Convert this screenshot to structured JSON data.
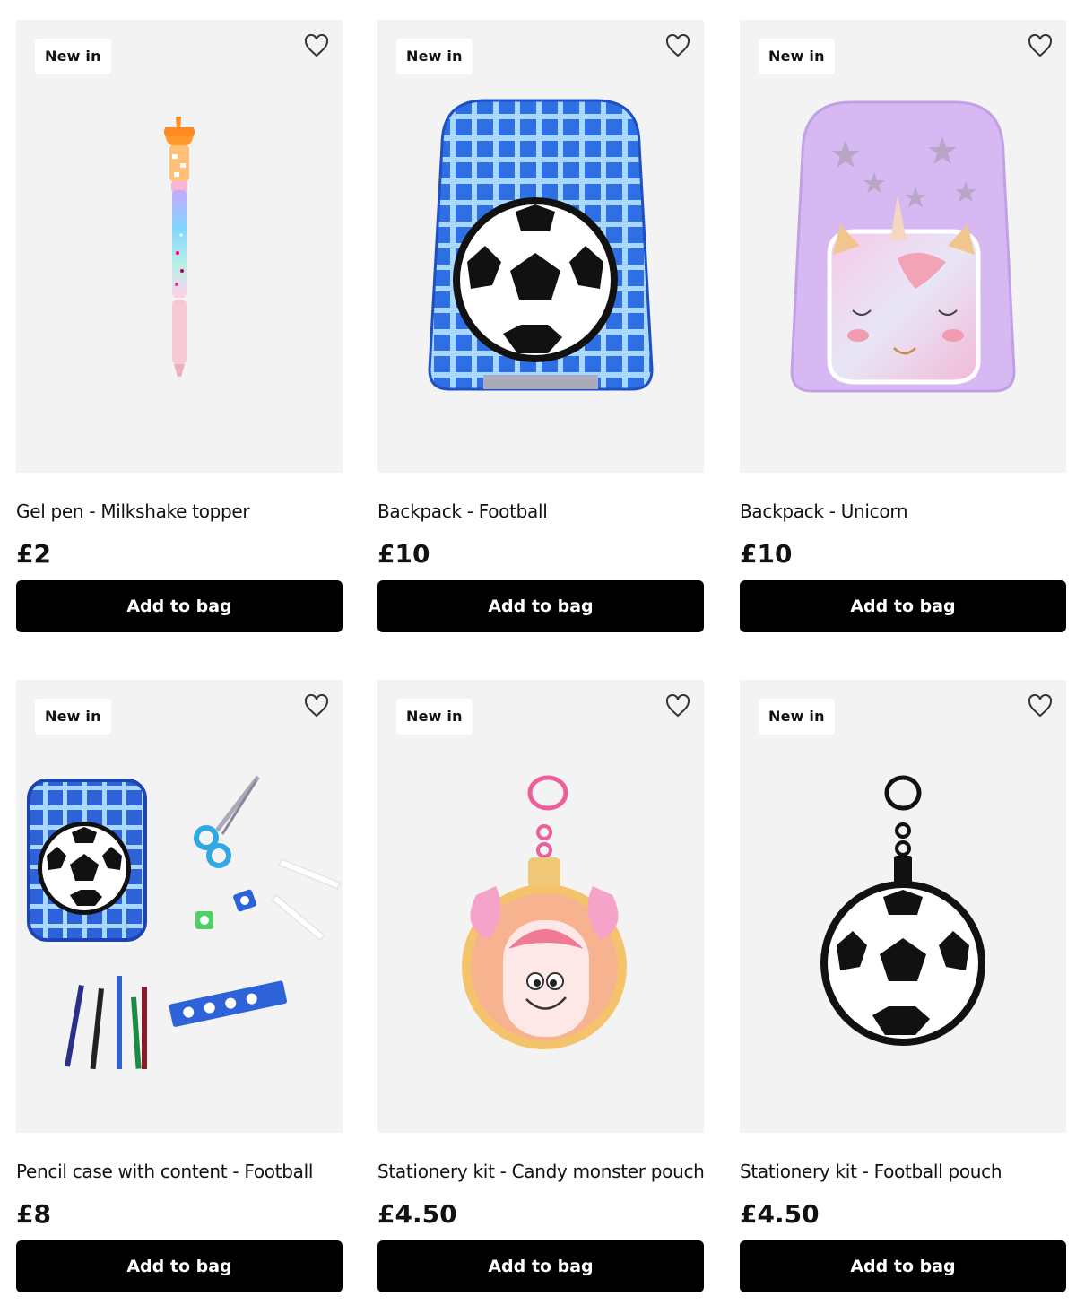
{
  "products": [
    {
      "badge": "New in",
      "name": "Gel pen - Milkshake topper",
      "price": "£2",
      "cta": "Add to bag",
      "image": "gel-pen-image"
    },
    {
      "badge": "New in",
      "name": "Backpack - Football",
      "price": "£10",
      "cta": "Add to bag",
      "image": "football-backpack-image"
    },
    {
      "badge": "New in",
      "name": "Backpack - Unicorn",
      "price": "£10",
      "cta": "Add to bag",
      "image": "unicorn-backpack-image"
    },
    {
      "badge": "New in",
      "name": "Pencil case with content - Football",
      "price": "£8",
      "cta": "Add to bag",
      "image": "pencil-case-image"
    },
    {
      "badge": "New in",
      "name": "Stationery kit - Candy monster pouch",
      "price": "£4.50",
      "cta": "Add to bag",
      "image": "candy-monster-pouch-image"
    },
    {
      "badge": "New in",
      "name": "Stationery kit - Football pouch",
      "price": "£4.50",
      "cta": "Add to bag",
      "image": "football-pouch-image"
    }
  ],
  "colors": {
    "image_bg": "#f3f3f3",
    "button_bg": "#000000",
    "button_text": "#ffffff",
    "badge_bg": "#ffffff"
  },
  "icons": {
    "favourite": "heart-outline-icon"
  }
}
